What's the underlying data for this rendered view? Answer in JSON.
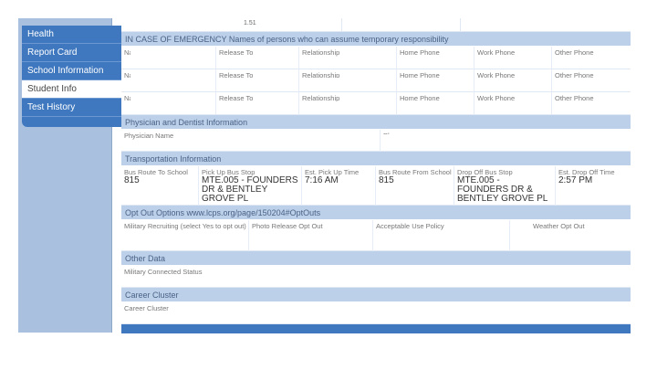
{
  "sidebar": {
    "items": [
      {
        "label": "Health",
        "active": false
      },
      {
        "label": "Report Card",
        "active": false
      },
      {
        "label": "School Information",
        "active": false
      },
      {
        "label": "Student Info",
        "active": true
      },
      {
        "label": "Test History",
        "active": false
      }
    ]
  },
  "top_fragment": "1.51",
  "emergency": {
    "header": "IN CASE OF EMERGENCY  Names of persons who can assume temporary responsibility",
    "columns": [
      "Name",
      "Release To",
      "Relationship",
      "Home Phone",
      "Work Phone",
      "Other Phone"
    ]
  },
  "physician": {
    "header": "Physician and Dentist Information",
    "name_label": "Physician Name",
    "phone_label": "Phone"
  },
  "transportation": {
    "header": "Transportation Information",
    "bus_route_to_label": "Bus Route To School",
    "bus_route_to": "815",
    "pickup_stop_label": "Pick Up Bus Stop",
    "pickup_stop": "MTE.005 - FOUNDERS DR & BENTLEY GROVE PL",
    "pickup_time_label": "Est. Pick Up Time",
    "pickup_time": "7:16 AM",
    "bus_route_from_label": "Bus Route From School",
    "bus_route_from": "815",
    "dropoff_stop_label": "Drop Off Bus Stop",
    "dropoff_stop": "MTE.005 - FOUNDERS DR & BENTLEY GROVE PL",
    "dropoff_time_label": "Est. Drop Off Time",
    "dropoff_time": "2:57 PM"
  },
  "opt_out": {
    "header": "Opt Out Options www.lcps.org/page/150204#OptOuts",
    "military_label": "Military Recruiting (select Yes to opt out)",
    "photo_label": "Photo Release Opt Out",
    "aup_label": "Acceptable Use Policy",
    "weather_label": "Weather Opt Out"
  },
  "other_data": {
    "header": "Other Data",
    "military_connected_label": "Military Connected Status"
  },
  "career_cluster": {
    "header": "Career Cluster",
    "label": "Career Cluster"
  }
}
